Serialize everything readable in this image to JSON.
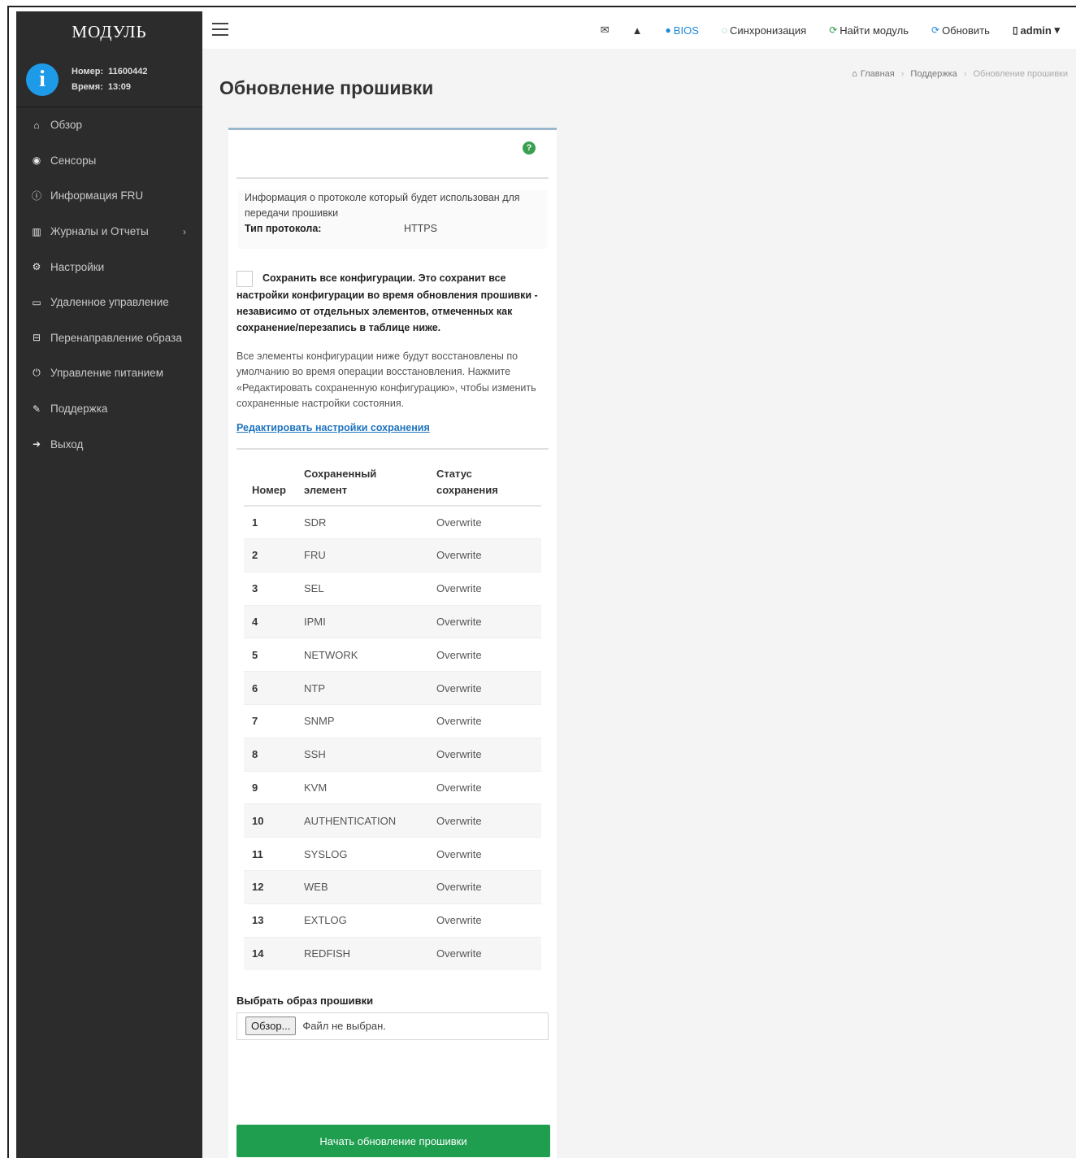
{
  "sidebar": {
    "brand": "МОДУЛЬ",
    "info_icon": "i",
    "number_label": "Номер:",
    "number_value": "11600442",
    "time_label": "Время:",
    "time_value": "13:09",
    "items": [
      {
        "label": "Обзор",
        "icon": "home-icon",
        "glyph": "⌂"
      },
      {
        "label": "Сенсоры",
        "icon": "sensors-icon",
        "glyph": "◉"
      },
      {
        "label": "Информация FRU",
        "icon": "info-icon",
        "glyph": "ⓘ"
      },
      {
        "label": "Журналы и Отчеты",
        "icon": "chart-icon",
        "glyph": "▥",
        "chevron": "›"
      },
      {
        "label": "Настройки",
        "icon": "gear-icon",
        "glyph": "⚙"
      },
      {
        "label": "Удаленное управление",
        "icon": "monitor-icon",
        "glyph": "▭"
      },
      {
        "label": "Перенаправление образа",
        "icon": "disk-icon",
        "glyph": "⊟"
      },
      {
        "label": "Управление питанием",
        "icon": "power-icon",
        "glyph": "⏻"
      },
      {
        "label": "Поддержка",
        "icon": "wrench-icon",
        "glyph": "✎"
      },
      {
        "label": "Выход",
        "icon": "logout-icon",
        "glyph": "➜"
      }
    ]
  },
  "topbar": {
    "mail_glyph": "✉",
    "alert_glyph": "▲",
    "bios": "BIOS",
    "sync": "Синхронизация",
    "find_module": "Найти модуль",
    "refresh": "Обновить",
    "user": "admin",
    "user_caret": "▾",
    "colors": {
      "blue": "#1e8ad8",
      "teal": "#2aa0a0",
      "green": "#2a9a4a"
    }
  },
  "page": {
    "title": "Обновление прошивки",
    "breadcrumb": {
      "home": "Главная",
      "support": "Поддержка",
      "current": "Обновление прошивки"
    }
  },
  "protocol": {
    "info": "Информация о протоколе который будет использован для передачи прошивки",
    "type_label": "Тип протокола:",
    "type_value": "HTTPS"
  },
  "preserve": {
    "checkbox_text": "Сохранить все конфигурации. Это сохранит все настройки конфигурации во время обновления прошивки - независимо от отдельных элементов, отмеченных как сохранение/перезапись в таблице ниже.",
    "description": "Все элементы конфигурации ниже будут восстановлены по умолчанию во время операции восстановления. Нажмите «Редактировать сохраненную конфигурацию», чтобы изменить сохраненные настройки состояния.",
    "edit_link": "Редактировать настройки сохранения"
  },
  "table": {
    "headers": [
      "Номер",
      "Сохраненный элемент",
      "Статус сохранения"
    ],
    "rows": [
      [
        "1",
        "SDR",
        "Overwrite"
      ],
      [
        "2",
        "FRU",
        "Overwrite"
      ],
      [
        "3",
        "SEL",
        "Overwrite"
      ],
      [
        "4",
        "IPMI",
        "Overwrite"
      ],
      [
        "5",
        "NETWORK",
        "Overwrite"
      ],
      [
        "6",
        "NTP",
        "Overwrite"
      ],
      [
        "7",
        "SNMP",
        "Overwrite"
      ],
      [
        "8",
        "SSH",
        "Overwrite"
      ],
      [
        "9",
        "KVM",
        "Overwrite"
      ],
      [
        "10",
        "AUTHENTICATION",
        "Overwrite"
      ],
      [
        "11",
        "SYSLOG",
        "Overwrite"
      ],
      [
        "12",
        "WEB",
        "Overwrite"
      ],
      [
        "13",
        "EXTLOG",
        "Overwrite"
      ],
      [
        "14",
        "REDFISH",
        "Overwrite"
      ]
    ]
  },
  "firmware": {
    "select_label": "Выбрать образ прошивки",
    "browse": "Обзор...",
    "no_file": "Файл не выбран.",
    "start_button": "Начать обновление прошивки"
  }
}
